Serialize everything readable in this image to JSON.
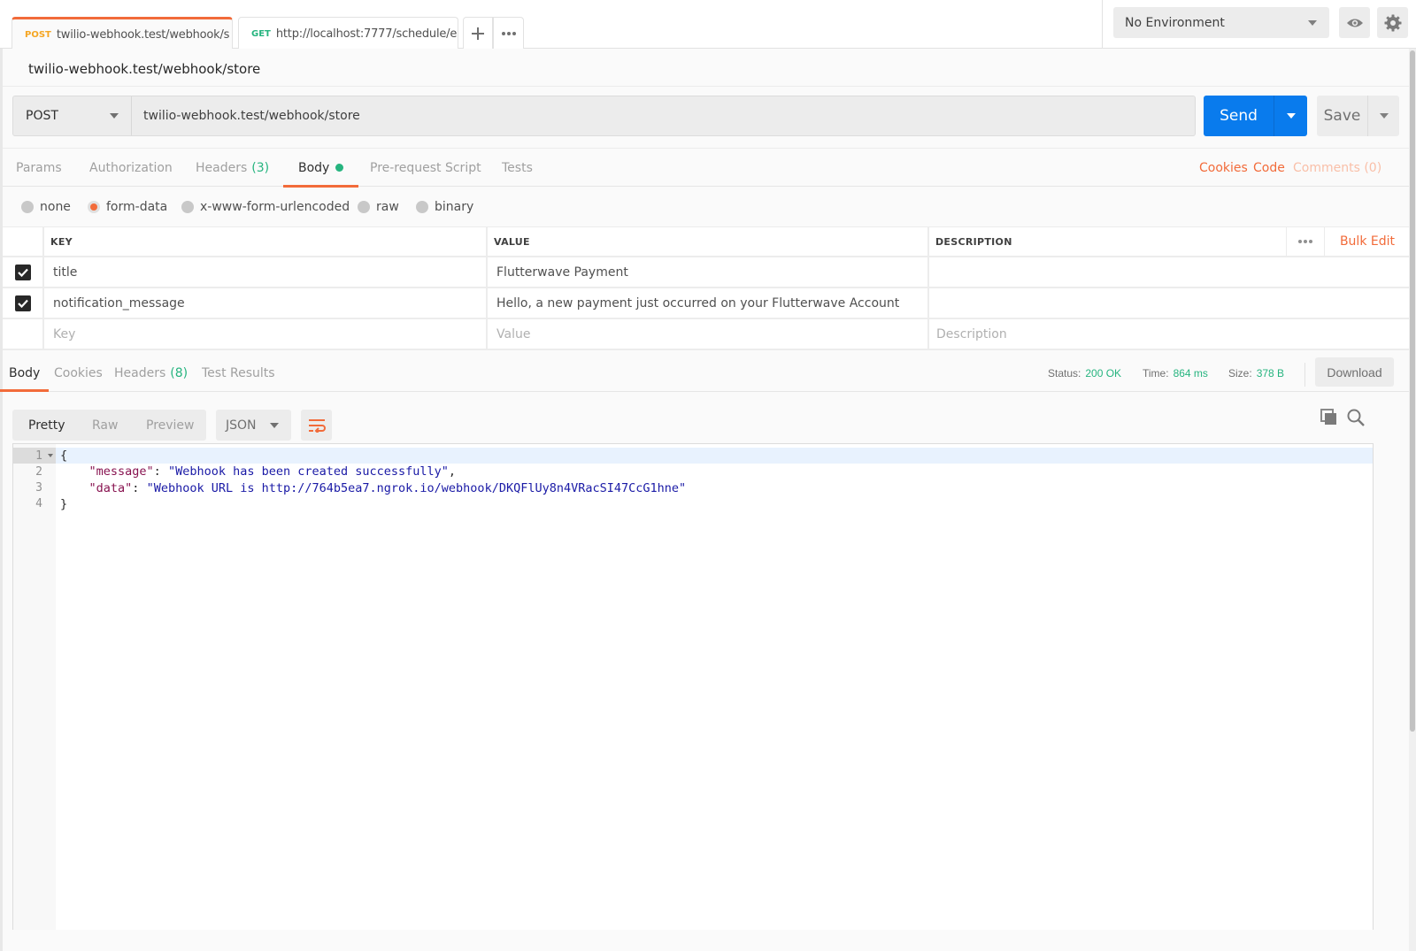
{
  "tabs": [
    {
      "method": "POST",
      "method_color": "#f5a623",
      "name": "twilio-webhook.test/webhook/s",
      "unsaved": true,
      "active": true
    },
    {
      "method": "GET",
      "method_color": "#26b47f",
      "name": "http://localhost:7777/schedule/e",
      "unsaved": true,
      "active": false
    }
  ],
  "tab_actions": {
    "new_tab_icon": "plus-icon",
    "more_icon": "ellipsis-icon"
  },
  "environment": {
    "selected": "No Environment",
    "eye_icon": "eye-icon",
    "settings_icon": "gear-icon"
  },
  "request": {
    "title": "twilio-webhook.test/webhook/store",
    "method": "POST",
    "url": "twilio-webhook.test/webhook/store",
    "send_label": "Send",
    "save_label": "Save"
  },
  "request_tabs": [
    {
      "label": "Params",
      "count": null
    },
    {
      "label": "Authorization",
      "count": null
    },
    {
      "label": "Headers",
      "count": "(3)"
    },
    {
      "label": "Body",
      "count": null,
      "active": true,
      "indicator": true
    },
    {
      "label": "Pre-request Script",
      "count": null
    },
    {
      "label": "Tests",
      "count": null
    }
  ],
  "request_links": {
    "cookies": "Cookies",
    "code": "Code",
    "comments": "Comments (0)"
  },
  "body_types": [
    {
      "label": "none",
      "checked": false
    },
    {
      "label": "form-data",
      "checked": true
    },
    {
      "label": "x-www-form-urlencoded",
      "checked": false
    },
    {
      "label": "raw",
      "checked": false
    },
    {
      "label": "binary",
      "checked": false
    }
  ],
  "form_table": {
    "headers": {
      "key": "KEY",
      "value": "VALUE",
      "description": "DESCRIPTION"
    },
    "bulk_edit": "Bulk Edit",
    "rows": [
      {
        "enabled": true,
        "key": "title",
        "value": "Flutterwave Payment",
        "description": ""
      },
      {
        "enabled": true,
        "key": "notification_message",
        "value": "Hello, a new payment just occurred on your Flutterwave Account",
        "description": ""
      }
    ],
    "placeholders": {
      "key": "Key",
      "value": "Value",
      "description": "Description"
    }
  },
  "response_tabs": [
    {
      "label": "Body",
      "count": null,
      "active": true
    },
    {
      "label": "Cookies",
      "count": null
    },
    {
      "label": "Headers",
      "count": "(8)"
    },
    {
      "label": "Test Results",
      "count": null
    }
  ],
  "response_meta": {
    "status_label": "Status:",
    "status": "200 OK",
    "time_label": "Time:",
    "time": "864 ms",
    "size_label": "Size:",
    "size": "378 B",
    "download_label": "Download",
    "value_color": "#26b47f"
  },
  "response_view": {
    "modes": [
      "Pretty",
      "Raw",
      "Preview"
    ],
    "active_mode": "Pretty",
    "format": "JSON",
    "wrap_icon": "wrap-lines-icon",
    "copy_icon": "copy-icon",
    "search_icon": "search-icon"
  },
  "response_body": {
    "lines": [
      {
        "n": "1",
        "tokens": [
          {
            "t": "punc",
            "v": "{"
          }
        ]
      },
      {
        "n": "2",
        "tokens": [
          {
            "t": "punc",
            "v": "    "
          },
          {
            "t": "key",
            "v": "\"message\""
          },
          {
            "t": "punc",
            "v": ": "
          },
          {
            "t": "str",
            "v": "\"Webhook has been created successfully\""
          },
          {
            "t": "punc",
            "v": ","
          }
        ]
      },
      {
        "n": "3",
        "tokens": [
          {
            "t": "punc",
            "v": "    "
          },
          {
            "t": "key",
            "v": "\"data\""
          },
          {
            "t": "punc",
            "v": ": "
          },
          {
            "t": "str",
            "v": "\"Webhook URL is http://764b5ea7.ngrok.io/webhook/DKQFlUy8n4VRacSI47CcG1hne\""
          }
        ]
      },
      {
        "n": "4",
        "tokens": [
          {
            "t": "punc",
            "v": "}"
          }
        ]
      }
    ]
  },
  "colors": {
    "accent": "#f26b3a",
    "primary": "#097bed",
    "success": "#26b47f"
  }
}
